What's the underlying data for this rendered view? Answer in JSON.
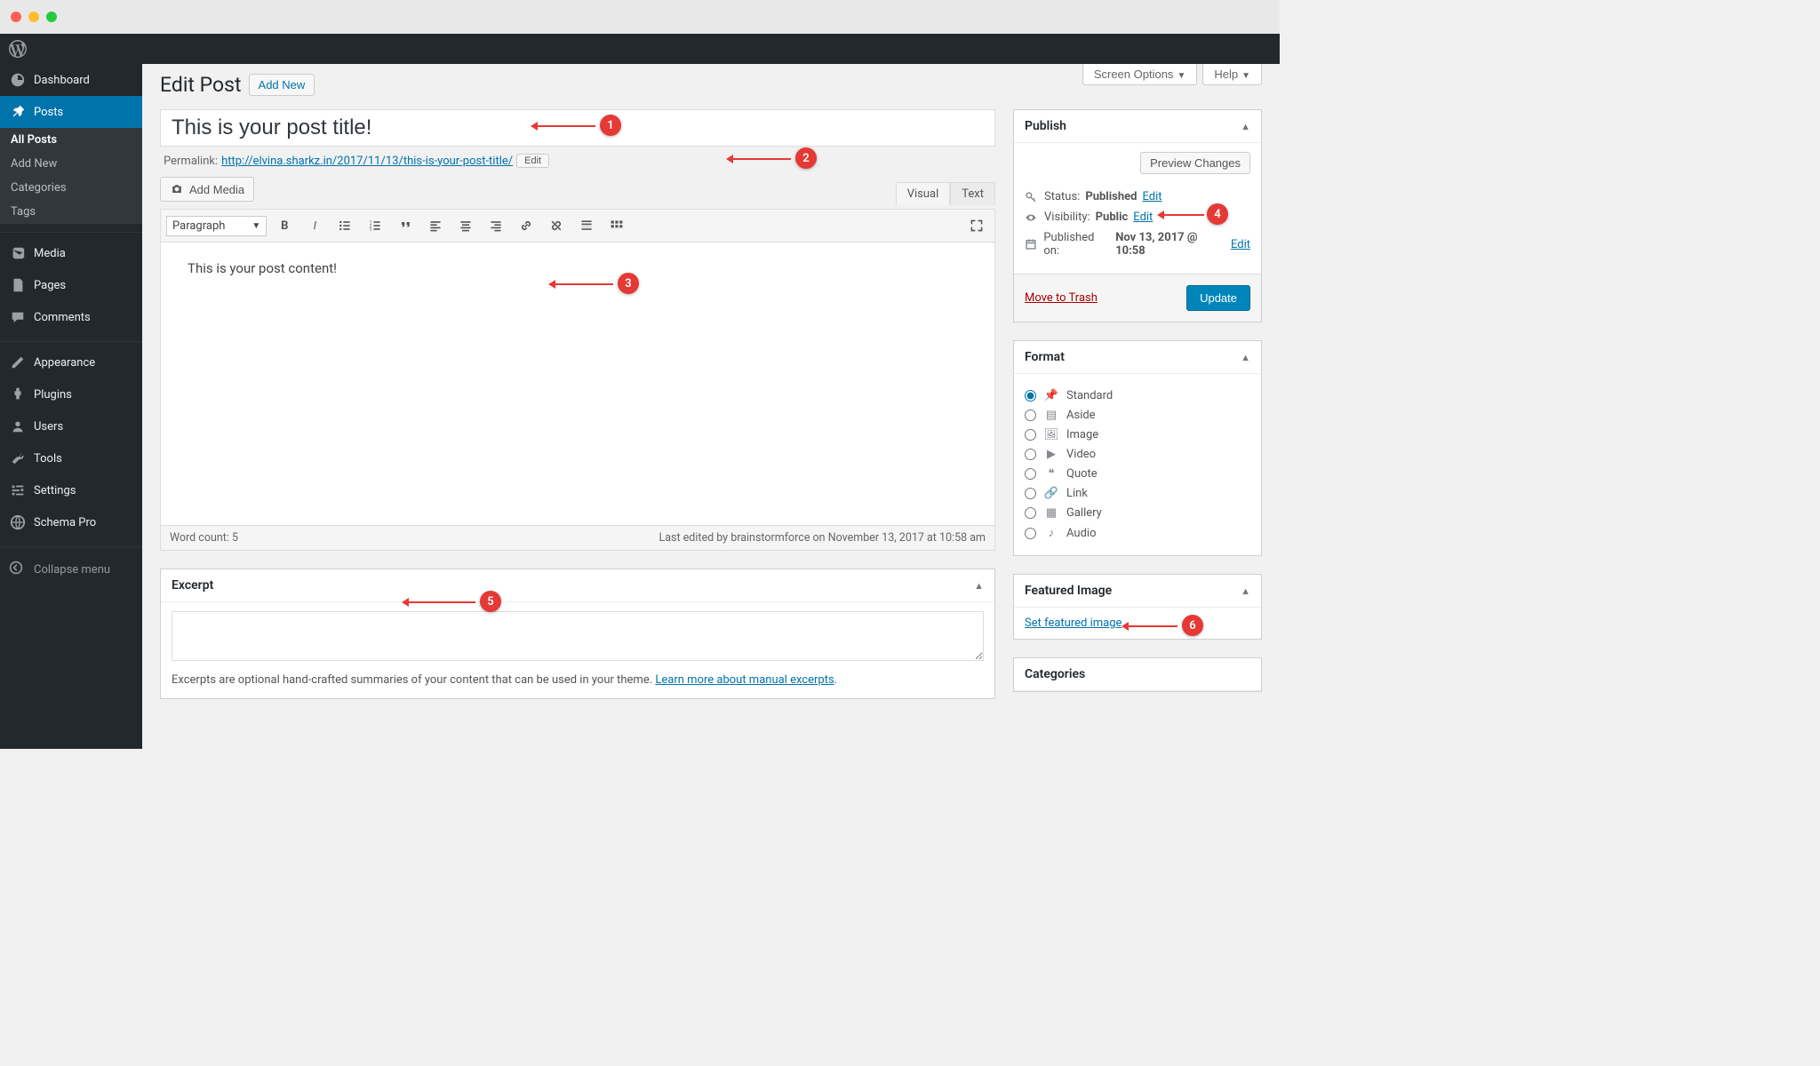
{
  "screenMeta": {
    "screenOptions": "Screen Options",
    "help": "Help"
  },
  "sidebar": {
    "dashboard": "Dashboard",
    "posts": "Posts",
    "postsSub": [
      "All Posts",
      "Add New",
      "Categories",
      "Tags"
    ],
    "media": "Media",
    "pages": "Pages",
    "comments": "Comments",
    "appearance": "Appearance",
    "plugins": "Plugins",
    "users": "Users",
    "tools": "Tools",
    "settings": "Settings",
    "schemaPro": "Schema Pro",
    "collapse": "Collapse menu"
  },
  "heading": {
    "title": "Edit Post",
    "addNew": "Add New"
  },
  "post": {
    "titleValue": "This is your post title!",
    "permalinkLabel": "Permalink:",
    "permalinkBase": "http://elvina.sharkz.in/2017/11/13/",
    "permalinkSlug": "this-is-your-post-title/",
    "permalinkEdit": "Edit",
    "addMedia": "Add Media",
    "formatSelect": "Paragraph",
    "tabs": {
      "visual": "Visual",
      "text": "Text"
    },
    "content": "This is your post content!",
    "wordCountLabel": "Word count: 5",
    "lastEdited": "Last edited by brainstormforce on November 13, 2017 at 10:58 am"
  },
  "excerpt": {
    "title": "Excerpt",
    "desc": "Excerpts are optional hand-crafted summaries of your content that can be used in your theme. ",
    "learnMore": "Learn more about manual excerpts",
    "period": "."
  },
  "publish": {
    "title": "Publish",
    "previewChanges": "Preview Changes",
    "statusLabel": "Status:",
    "statusValue": "Published",
    "visibilityLabel": "Visibility:",
    "visibilityValue": "Public",
    "publishedLabel": "Published on:",
    "publishedValue": "Nov 13, 2017 @ 10:58",
    "editLink": "Edit",
    "trash": "Move to Trash",
    "update": "Update"
  },
  "format": {
    "title": "Format",
    "options": [
      "Standard",
      "Aside",
      "Image",
      "Video",
      "Quote",
      "Link",
      "Gallery",
      "Audio"
    ]
  },
  "featuredImage": {
    "title": "Featured Image",
    "setLink": "Set featured image"
  },
  "categories": {
    "title": "Categories"
  },
  "annotations": {
    "a1": "1",
    "a2": "2",
    "a3": "3",
    "a4": "4",
    "a5": "5",
    "a6": "6"
  }
}
